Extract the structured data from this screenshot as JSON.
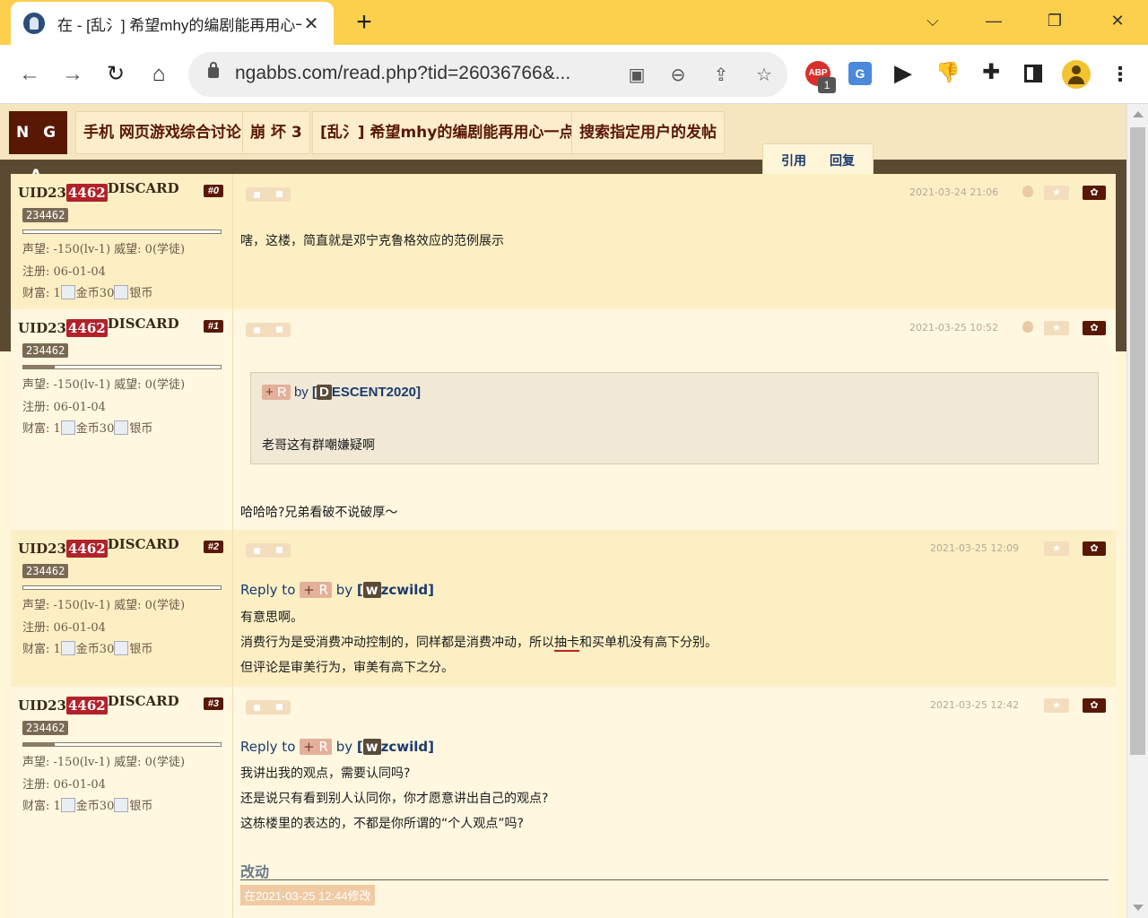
{
  "browser": {
    "tab_title": "在 - [乱氵] 希望mhy的编剧能再用心一点",
    "tab_close": "✕",
    "new_tab": "+",
    "window": {
      "minimize": "—",
      "restore": "❐",
      "close": "✕"
    },
    "url": "ngabbs.com/read.php?tid=26036766&...",
    "nav": {
      "back": "←",
      "forward": "→",
      "reload": "↻",
      "home": "⌂"
    },
    "extensions": {
      "abp_label": "ABP",
      "abp_badge": "1",
      "translate_label": "G"
    }
  },
  "page": {
    "logo": "N G A",
    "breadcrumbs": [
      "手机 网页游戏综合讨论",
      "崩 坏 3",
      "[乱氵] 希望mhy的编剧能再用心一点",
      "搜索指定用户的发帖"
    ],
    "quick_actions": {
      "quote": "引用",
      "reply": "回复"
    },
    "posts": [
      {
        "uid_prefix": "UID23",
        "uid_highlight": "4462",
        "uid_suffix": "DISCARD",
        "floor": "#0",
        "uid_box": "234462",
        "stat_rep": "声望: -150(lv-1) 威望: 0(学徒)",
        "stat_reg": "注册: 06-01-04",
        "stat_wealth_a": "财富: 1",
        "stat_gold": "金币30",
        "stat_silver": "银币",
        "time": "2021-03-24 21:06",
        "content": "嗐，这楼，简直就是邓宁克鲁格效应的范例展示"
      },
      {
        "uid_prefix": "UID23",
        "uid_highlight": "4462",
        "uid_suffix": "DISCARD",
        "floor": "#1",
        "uid_box": "234462",
        "stat_rep": "声望: -150(lv-1) 威望: 0(学徒)",
        "stat_reg": "注册: 06-01-04",
        "stat_wealth_a": "财富: 1",
        "stat_gold": "金币30",
        "stat_silver": "银币",
        "time": "2021-03-25 10:52",
        "quote": {
          "tag_plus": "+",
          "tag_r": "R",
          "by": "by",
          "initial": "D",
          "author": "ESCENT2020",
          "text": "老哥这有群嘲嫌疑啊"
        },
        "content": "哈哈哈?兄弟看破不说破厚～"
      },
      {
        "uid_prefix": "UID23",
        "uid_highlight": "4462",
        "uid_suffix": "DISCARD",
        "floor": "#2",
        "uid_box": "234462",
        "stat_rep": "声望: -150(lv-1) 威望: 0(学徒)",
        "stat_reg": "注册: 06-01-04",
        "stat_wealth_a": "财富: 1",
        "stat_gold": "金币30",
        "stat_silver": "银币",
        "time": "2021-03-25 12:09",
        "reply_to": "Reply to",
        "tag_plus": "+",
        "tag_r": "R",
        "by": "by",
        "initial": "w",
        "author": "zcwild",
        "lines": [
          "有意思啊。",
          "消费行为是受消费冲动控制的，同样都是消费冲动，所以抽卡和买单机没有高下分别。",
          "但评论是审美行为，审美有高下之分。"
        ],
        "line2_pre": "消费行为是受消费冲动控制的，同样都是消费冲动，所以",
        "line2_mark": "抽卡",
        "line2_post": "和买单机没有高下分别。"
      },
      {
        "uid_prefix": "UID23",
        "uid_highlight": "4462",
        "uid_suffix": "DISCARD",
        "floor": "#3",
        "uid_box": "234462",
        "stat_rep": "声望: -150(lv-1) 威望: 0(学徒)",
        "stat_reg": "注册: 06-01-04",
        "stat_wealth_a": "财富: 1",
        "stat_gold": "金币30",
        "stat_silver": "银币",
        "time": "2021-03-25 12:42",
        "reply_to": "Reply to",
        "tag_plus": "+",
        "tag_r": "R",
        "by": "by",
        "initial": "w",
        "author": "zcwild",
        "lines": [
          "我讲出我的观点，需要认同吗?",
          "还是说只有看到别人认同你，你才愿意讲出自己的观点?",
          "这栋楼里的表达的，不都是你所谓的“个人观点”吗?"
        ],
        "edit_title": "改动",
        "edit_note": "在2021-03-25 12:44修改"
      }
    ]
  },
  "colors": {
    "chrome_accent": "#fcd04d",
    "nga_brand": "#591804",
    "uid_highlight": "#b2222b"
  }
}
